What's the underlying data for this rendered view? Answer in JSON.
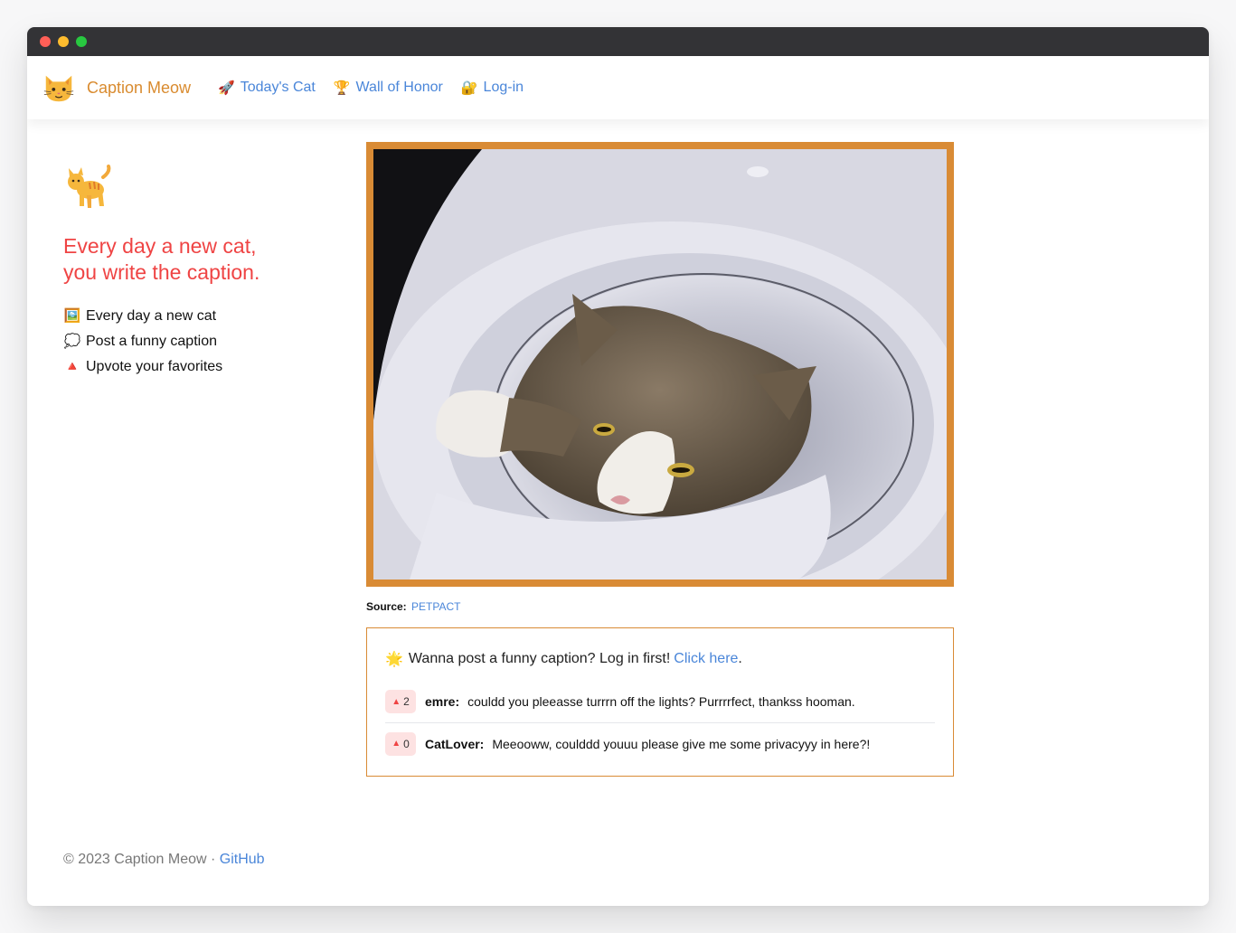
{
  "nav": {
    "brand": "Caption Meow",
    "links": [
      {
        "emoji": "🚀",
        "label": "Today's Cat"
      },
      {
        "emoji": "🏆",
        "label": "Wall of Honor"
      },
      {
        "emoji": "🔐",
        "label": "Log-in"
      }
    ]
  },
  "sidebar": {
    "tagline_line1": "Every day a new cat,",
    "tagline_line2": "you write the caption.",
    "features": [
      {
        "emoji": "🖼️",
        "label": "Every day a new cat"
      },
      {
        "emoji": "💭",
        "label": "Post a funny caption"
      },
      {
        "emoji": "🔺",
        "label": "Upvote your favorites"
      }
    ]
  },
  "photo": {
    "source_label": "Source:",
    "source_link": "PETPACT"
  },
  "captions": {
    "prompt_emoji": "🌟",
    "prompt_text": "Wanna post a funny caption? Log in first!",
    "prompt_link": "Click here",
    "prompt_suffix": ".",
    "items": [
      {
        "votes": "2",
        "author": "emre:",
        "text": "couldd you pleeasse turrrn off the lights? Purrrrfect, thankss hooman."
      },
      {
        "votes": "0",
        "author": "CatLover:",
        "text": "Meeooww, coulddd youuu please give me some privacyyy in here?!"
      }
    ]
  },
  "footer": {
    "text": "© 2023 Caption Meow · ",
    "link": "GitHub"
  },
  "colors": {
    "brand": "#d98b2f",
    "accent_link": "#4a86d9",
    "tagline": "#ef4444",
    "frame": "#d98b35"
  }
}
